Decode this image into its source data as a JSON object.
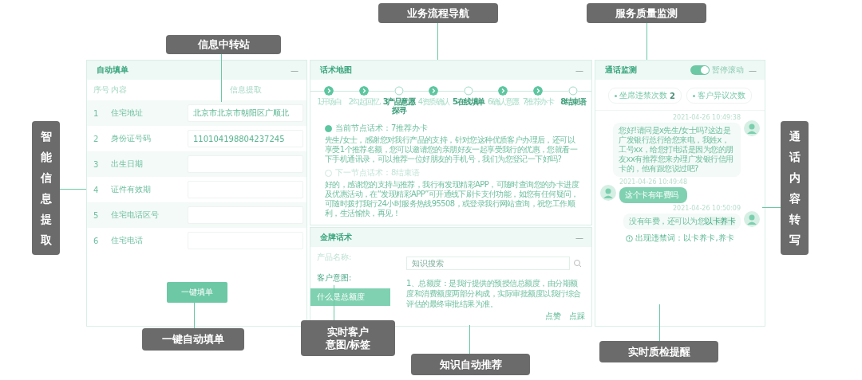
{
  "callouts": [
    {
      "kind": "top",
      "text": "信息中转站"
    },
    {
      "kind": "top",
      "text": "业务流程导航"
    },
    {
      "kind": "top",
      "text": "服务质量监测"
    },
    {
      "kind": "side",
      "text": "智能信息提取"
    },
    {
      "kind": "side",
      "text": "通话内容转写"
    },
    {
      "kind": "bottom",
      "text": "一键自动填单"
    },
    {
      "kind": "bottom",
      "text": "实时客户意图/标签"
    },
    {
      "kind": "bottom",
      "text": "知识自动推荐"
    },
    {
      "kind": "bottom",
      "text": "实时质检提醒"
    }
  ],
  "autofill": {
    "title": "自动填单",
    "collapse": "—",
    "columns": [
      "序号",
      "内容",
      "信息提取"
    ],
    "rows": [
      {
        "index": "1",
        "field": "住宅地址",
        "value": "北京市北京市朝阳区广顺北"
      },
      {
        "index": "2",
        "field": "身份证号码",
        "value": "110104198804237245"
      },
      {
        "index": "3",
        "field": "出生日期"
      },
      {
        "index": "4",
        "field": "证件有效期"
      },
      {
        "index": "5",
        "field": "住宅电话区号"
      },
      {
        "index": "6",
        "field": "住宅电话"
      }
    ],
    "button": "一键填单"
  },
  "script_map": {
    "title": "话术地图",
    "collapse": "—",
    "steps": [
      {
        "label": "1开场白",
        "done": true
      },
      {
        "label": "2勾起回忆",
        "done": true
      },
      {
        "label": "3产品意愿探寻",
        "done": false
      },
      {
        "label": "4资质确认",
        "done": true
      },
      {
        "label": "5在线填单",
        "done": false
      },
      {
        "label": "6确认意愿",
        "done": true
      },
      {
        "label": "7推荐办卡",
        "done": true
      },
      {
        "label": "8结束语",
        "done": false
      }
    ],
    "nodes": [
      {
        "heading": "当前节点话术：7推荐办卡",
        "selected": true,
        "text": "先生/女士，感谢您对我行产品的支持，针对您这种优质客户办理后，还可以享受1个推荐名额，您可以邀请您的亲朋好友一起享受我行的优惠，您就看一下手机通讯录，可以推荐一位好朋友的手机号，我们为您登记一下好吗?"
      },
      {
        "heading": "下一节点话术：8结束语",
        "selected": false,
        "text": "好的，感谢您的支持与推荐，我行有发现精彩APP，可随时查询您的办卡进度及优惠活动，在“发现精彩APP”可开通线下刷卡支付功能，如您有任何疑问，可随时拨打我行24小时服务热线95508，或登录我行网站查询，祝您工作顺利，生活愉快，再见！"
      }
    ]
  },
  "gold_script": {
    "title": "金牌话术",
    "collapse": "—",
    "product_label": "产品名称:",
    "intent_label": "客户意图:",
    "intents": [
      {
        "text": "什么是总额度",
        "selected": true
      }
    ],
    "search": {
      "placeholder": "知识搜索"
    },
    "answer": "1、总额度：是我行提供的预授信总额度，由分期额度和消费额度两部分构成，实际审批额度以我行综合评估的最终审批结果为准。",
    "actions": [
      "点赞",
      "点踩"
    ]
  },
  "call_monitor": {
    "title": "通话监测",
    "toggle": {
      "label": "暂停滚动",
      "on": true
    },
    "collapse": "—",
    "counters": [
      {
        "label": "坐席违禁次数",
        "count": "2"
      },
      {
        "label": "客户异议次数"
      }
    ],
    "messages": [
      {
        "kind": "agent",
        "time": "2021-04-26 10:49:38",
        "text": "您好!请问是x先生/女士吗?这边是广发银行总行给您来电，我姓x，工号xx，给您打电话是因为您的朋友xx有推荐您来办理广发银行信用卡的，他有跟您说过吧?"
      },
      {
        "kind": "customer",
        "time": "2021-04-26 10:49:48",
        "text": "这个卡有年费吗"
      },
      {
        "kind": "agent",
        "time": "2021-04-26 10:50:09",
        "text": "没有年费，还可以为您",
        "flagged": "以卡养卡"
      }
    ],
    "warning": "出现违禁词：以卡养卡,养卡"
  }
}
